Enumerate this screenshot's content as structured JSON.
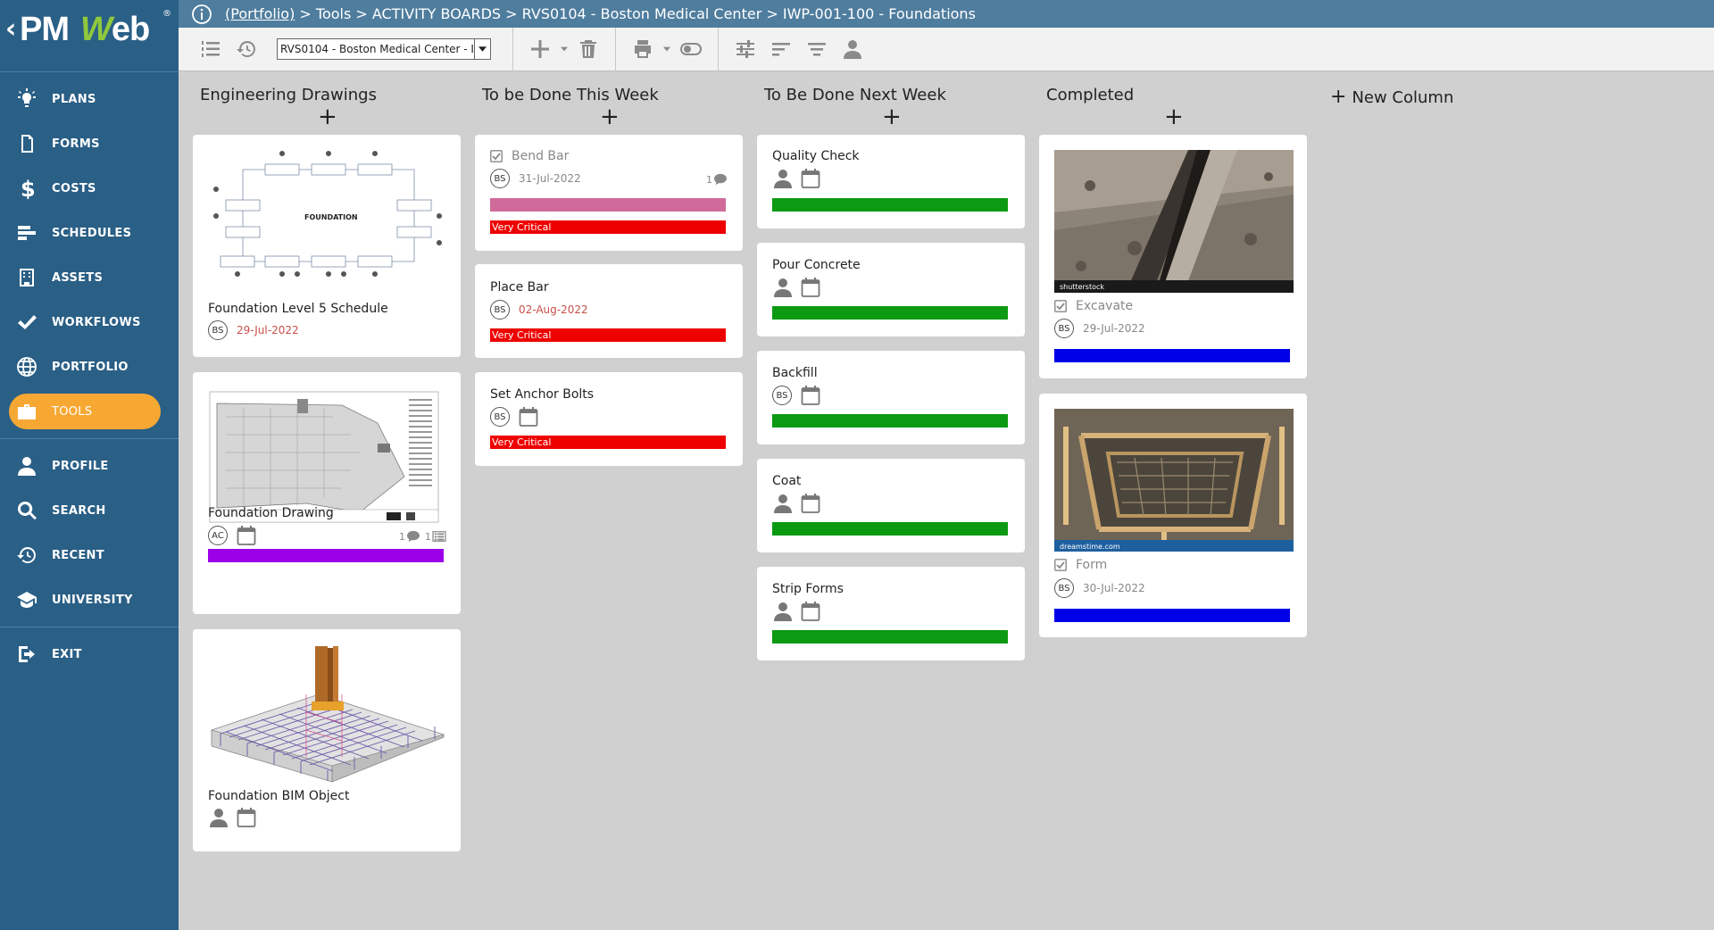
{
  "app": {
    "logo_text_pm": "PM",
    "logo_text_web": "Web",
    "logo_reg": "®"
  },
  "breadcrumb": {
    "root": "(Portfolio)",
    "rest": " > Tools > ACTIVITY BOARDS > RVS0104 - Boston Medical Center > IWP-001-100 - Foundations"
  },
  "nav": {
    "items": [
      {
        "label": "PLANS",
        "icon": "lightbulb-icon"
      },
      {
        "label": "FORMS",
        "icon": "document-icon"
      },
      {
        "label": "COSTS",
        "icon": "dollar-icon"
      },
      {
        "label": "SCHEDULES",
        "icon": "schedule-bars-icon"
      },
      {
        "label": "ASSETS",
        "icon": "building-icon"
      },
      {
        "label": "WORKFLOWS",
        "icon": "check-icon"
      },
      {
        "label": "PORTFOLIO",
        "icon": "globe-icon"
      },
      {
        "label": "TOOLS",
        "icon": "toolbox-icon"
      },
      {
        "label": "PROFILE",
        "icon": "person-icon"
      },
      {
        "label": "SEARCH",
        "icon": "search-icon"
      },
      {
        "label": "RECENT",
        "icon": "history-icon"
      },
      {
        "label": "UNIVERSITY",
        "icon": "graduation-cap-icon"
      },
      {
        "label": "EXIT",
        "icon": "exit-icon"
      }
    ],
    "active": "TOOLS"
  },
  "toolbar": {
    "project_value": "RVS0104 - Boston Medical Center - I"
  },
  "board": {
    "new_column_label": "New Column",
    "columns": [
      {
        "title": "Engineering Drawings",
        "cards": [
          {
            "title": "Foundation Level 5 Schedule",
            "assignee": "BS",
            "date": "29-Jul-2022",
            "diagram_title": "FOUNDATION"
          },
          {
            "title": "Foundation Drawing",
            "assignee": "AC",
            "comments": "1",
            "attachments": "1",
            "bar_color": "#9b00e8"
          },
          {
            "title": "Foundation BIM Object"
          }
        ]
      },
      {
        "title": "To be Done This Week",
        "cards": [
          {
            "title": "Bend Bar",
            "assignee": "BS",
            "date": "31-Jul-2022",
            "comments": "1",
            "bar_color": "#d06a9a",
            "priority": "Very Critical",
            "completed": true
          },
          {
            "title": "Place Bar",
            "assignee": "BS",
            "date": "02-Aug-2022",
            "priority": "Very Critical"
          },
          {
            "title": "Set Anchor Bolts",
            "assignee": "BS",
            "priority": "Very Critical"
          }
        ]
      },
      {
        "title": "To Be Done Next Week",
        "cards": [
          {
            "title": "Quality Check",
            "bar_color": "#0c9a12"
          },
          {
            "title": "Pour Concrete",
            "bar_color": "#0c9a12"
          },
          {
            "title": "Backfill",
            "assignee": "BS",
            "bar_color": "#0c9a12"
          },
          {
            "title": "Coat",
            "bar_color": "#0c9a12"
          },
          {
            "title": "Strip Forms",
            "bar_color": "#0c9a12"
          }
        ]
      },
      {
        "title": "Completed",
        "cards": [
          {
            "title": "Excavate",
            "assignee": "BS",
            "date": "29-Jul-2022",
            "bar_color": "#0000e8",
            "completed": true,
            "photo_credit": "shutterstock"
          },
          {
            "title": "Form",
            "assignee": "BS",
            "date": "30-Jul-2022",
            "bar_color": "#0000e8",
            "completed": true,
            "photo_credit": "dreamstime.com"
          }
        ]
      }
    ]
  },
  "colors": {
    "sidebar": "#2a5f86",
    "active_nav": "#f7a833",
    "critical": "#ef0000",
    "header": "#4f7d9e"
  }
}
